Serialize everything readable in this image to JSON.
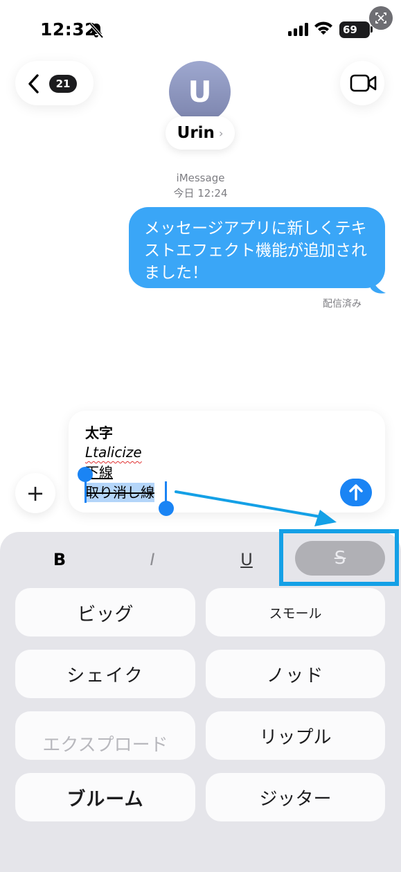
{
  "status_bar": {
    "time": "12:32",
    "battery": "69"
  },
  "header": {
    "back_badge": "21",
    "avatar_initial": "U",
    "contact_name": "Urin",
    "name_chevron": "›"
  },
  "conversation": {
    "service": "iMessage",
    "timestamp": "今日 12:24",
    "message": "メッセージアプリに新しくテキストエフェクト機能が追加されました！",
    "delivered": "配信済み"
  },
  "compose": {
    "plus": "+",
    "lines": [
      "太字",
      "Ltalicize",
      "下線",
      "取り消し線"
    ]
  },
  "format_bar": {
    "bold": "B",
    "italic": "I",
    "underline": "U",
    "strike": "S"
  },
  "effects": [
    "ビッグ",
    "スモール",
    "シェイク",
    "ノッド",
    "エクスプロード",
    "リップル",
    "ブルーム",
    "ジッター"
  ],
  "colors": {
    "bubble": "#3aa6f7",
    "accent": "#1a84f4",
    "highlight_box": "#14a0e6",
    "panel": "#e5e5ea"
  }
}
